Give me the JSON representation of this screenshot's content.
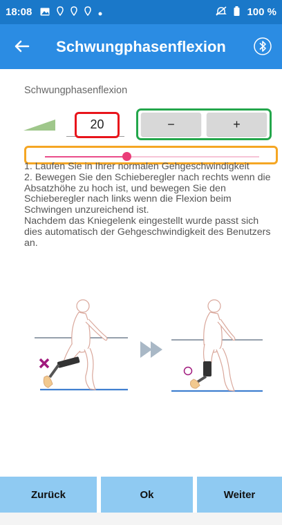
{
  "status_bar": {
    "time": "18:08",
    "battery": "100 %",
    "icons": [
      "image-icon",
      "location-icon",
      "location-icon",
      "location-icon",
      "dot-icon",
      "mute-icon",
      "battery-icon"
    ]
  },
  "app_bar": {
    "title": "Schwungphasenflexion",
    "back_icon": "arrow-left-icon",
    "bluetooth_icon": "bluetooth-icon"
  },
  "main": {
    "section_label": "Schwungphasenflexion",
    "value": "20",
    "minus_label": "−",
    "plus_label": "+",
    "slider_fraction": 0.38,
    "instructions": [
      "1. Laufen Sie in Ihrer normalen Gehgeschwindigkeit",
      "2. Bewegen Sie den Schieberegler nach rechts wenn die Absatzhöhe zu hoch ist, und bewegen Sie den Schieberegler nach links wenn die Flexion beim Schwingen unzureichend ist.",
      "Nachdem das Kniegelenk eingestellt wurde passt sich dies automatisch der Gehgeschwindigkeit des Benutzers an."
    ]
  },
  "buttons": {
    "back": "Zurück",
    "ok": "Ok",
    "next": "Weiter"
  },
  "colors": {
    "status_bar": "#1a78c9",
    "app_bar": "#2b8ce3",
    "bottom_button": "#8fcaf2",
    "value_highlight": "#e8141b",
    "stepper_highlight": "#23a64b",
    "slider_highlight": "#f5a623",
    "slider_thumb": "#ea3c78"
  }
}
